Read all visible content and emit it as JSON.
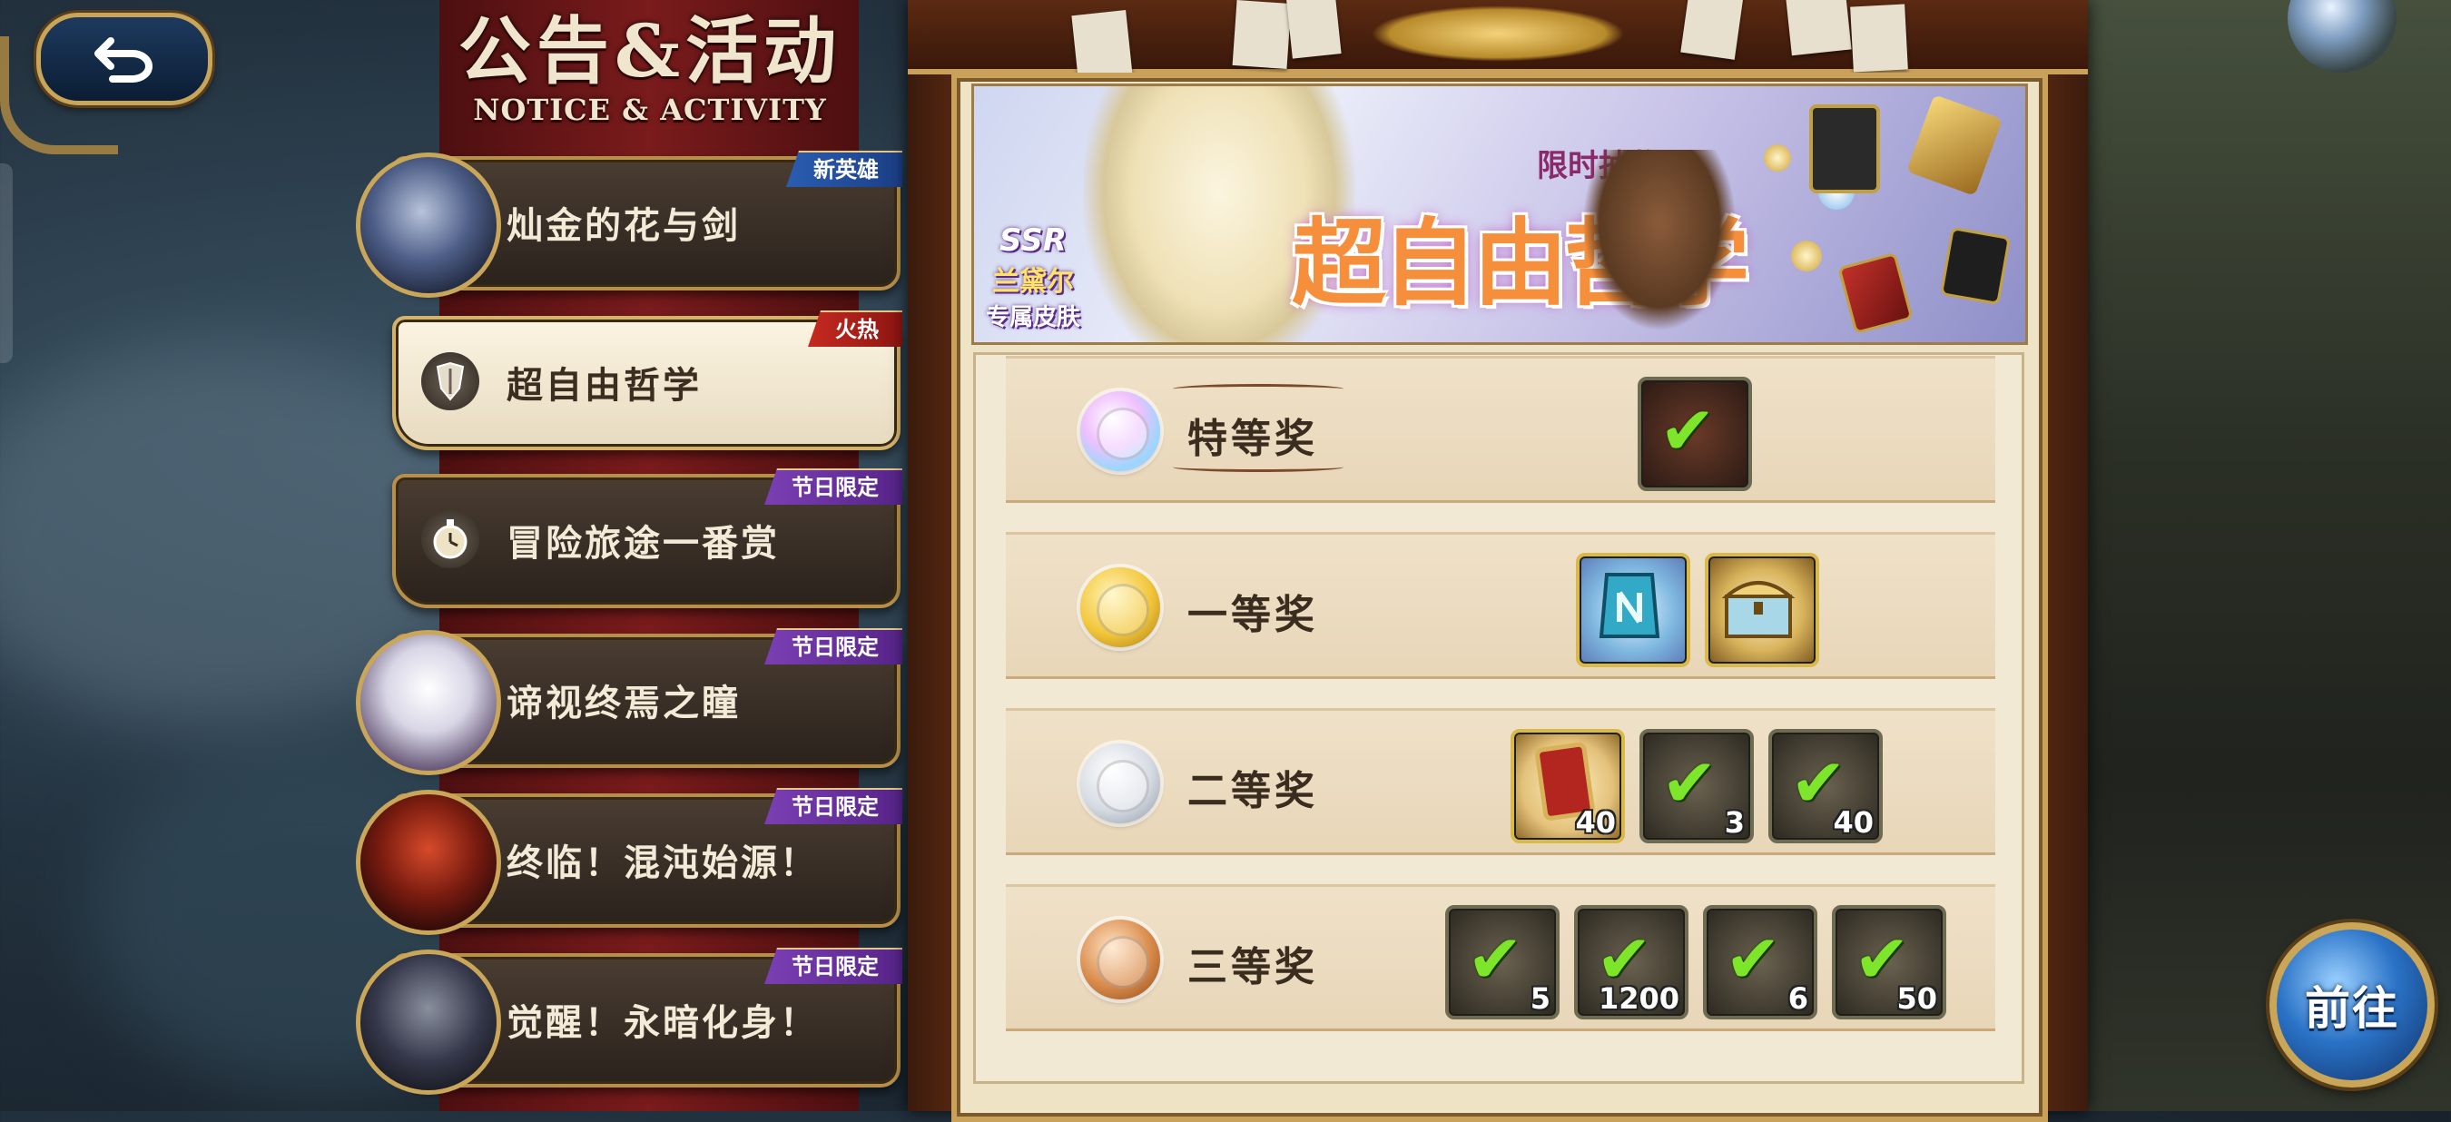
{
  "sidebar": {
    "title_zh": "公告&活动",
    "title_en": "NOTICE & ACTIVITY",
    "items": [
      {
        "label": "灿金的花与剑",
        "tag": "新英雄",
        "tag_color": "#2a5db0",
        "active": false
      },
      {
        "label": "超自由哲学",
        "tag": "火热",
        "tag_color": "#c62a20",
        "active": true
      },
      {
        "label": "冒险旅途一番赏",
        "tag": "节日限定",
        "tag_color": "#7b3fb3",
        "active": false
      },
      {
        "label": "谛视终焉之瞳",
        "tag": "节日限定",
        "tag_color": "#7b3fb3",
        "active": false
      },
      {
        "label": "终临！混沌始源！",
        "tag": "节日限定",
        "tag_color": "#7b3fb3",
        "active": false
      },
      {
        "label": "觉醒！永暗化身！",
        "tag": "节日限定",
        "tag_color": "#7b3fb3",
        "active": false
      }
    ]
  },
  "banner": {
    "ssr_line1": "SSR",
    "ssr_line2": "兰黛尔",
    "ssr_line3": "专属皮肤",
    "limited_label": "限时抽奖",
    "title": "超自由哲学"
  },
  "prizes": [
    {
      "name": "特等奖",
      "medal_color": "#c9b6f0",
      "rewards": [
        {
          "qty": "",
          "checked": true
        }
      ]
    },
    {
      "name": "一等奖",
      "medal_color": "#f2c63a",
      "rewards": [
        {
          "qty": "",
          "checked": false,
          "icon": "rune-stone-icon"
        },
        {
          "qty": "",
          "checked": false,
          "icon": "treasure-chest-icon"
        }
      ]
    },
    {
      "name": "二等奖",
      "medal_color": "#d6dbe3",
      "rewards": [
        {
          "qty": "40",
          "checked": false,
          "icon": "red-card-icon"
        },
        {
          "qty": "3",
          "checked": true
        },
        {
          "qty": "40",
          "checked": true
        }
      ]
    },
    {
      "name": "三等奖",
      "medal_color": "#d98a4a",
      "rewards": [
        {
          "qty": "5",
          "checked": true
        },
        {
          "qty": "1200",
          "checked": true
        },
        {
          "qty": "6",
          "checked": true
        },
        {
          "qty": "50",
          "checked": true
        }
      ]
    }
  ],
  "goto_label": "前往",
  "icons": {
    "back": "back-arrow-icon",
    "check": "✔"
  },
  "colors": {
    "frame_gold": "#c9a15a",
    "check_green": "#7de62b"
  }
}
